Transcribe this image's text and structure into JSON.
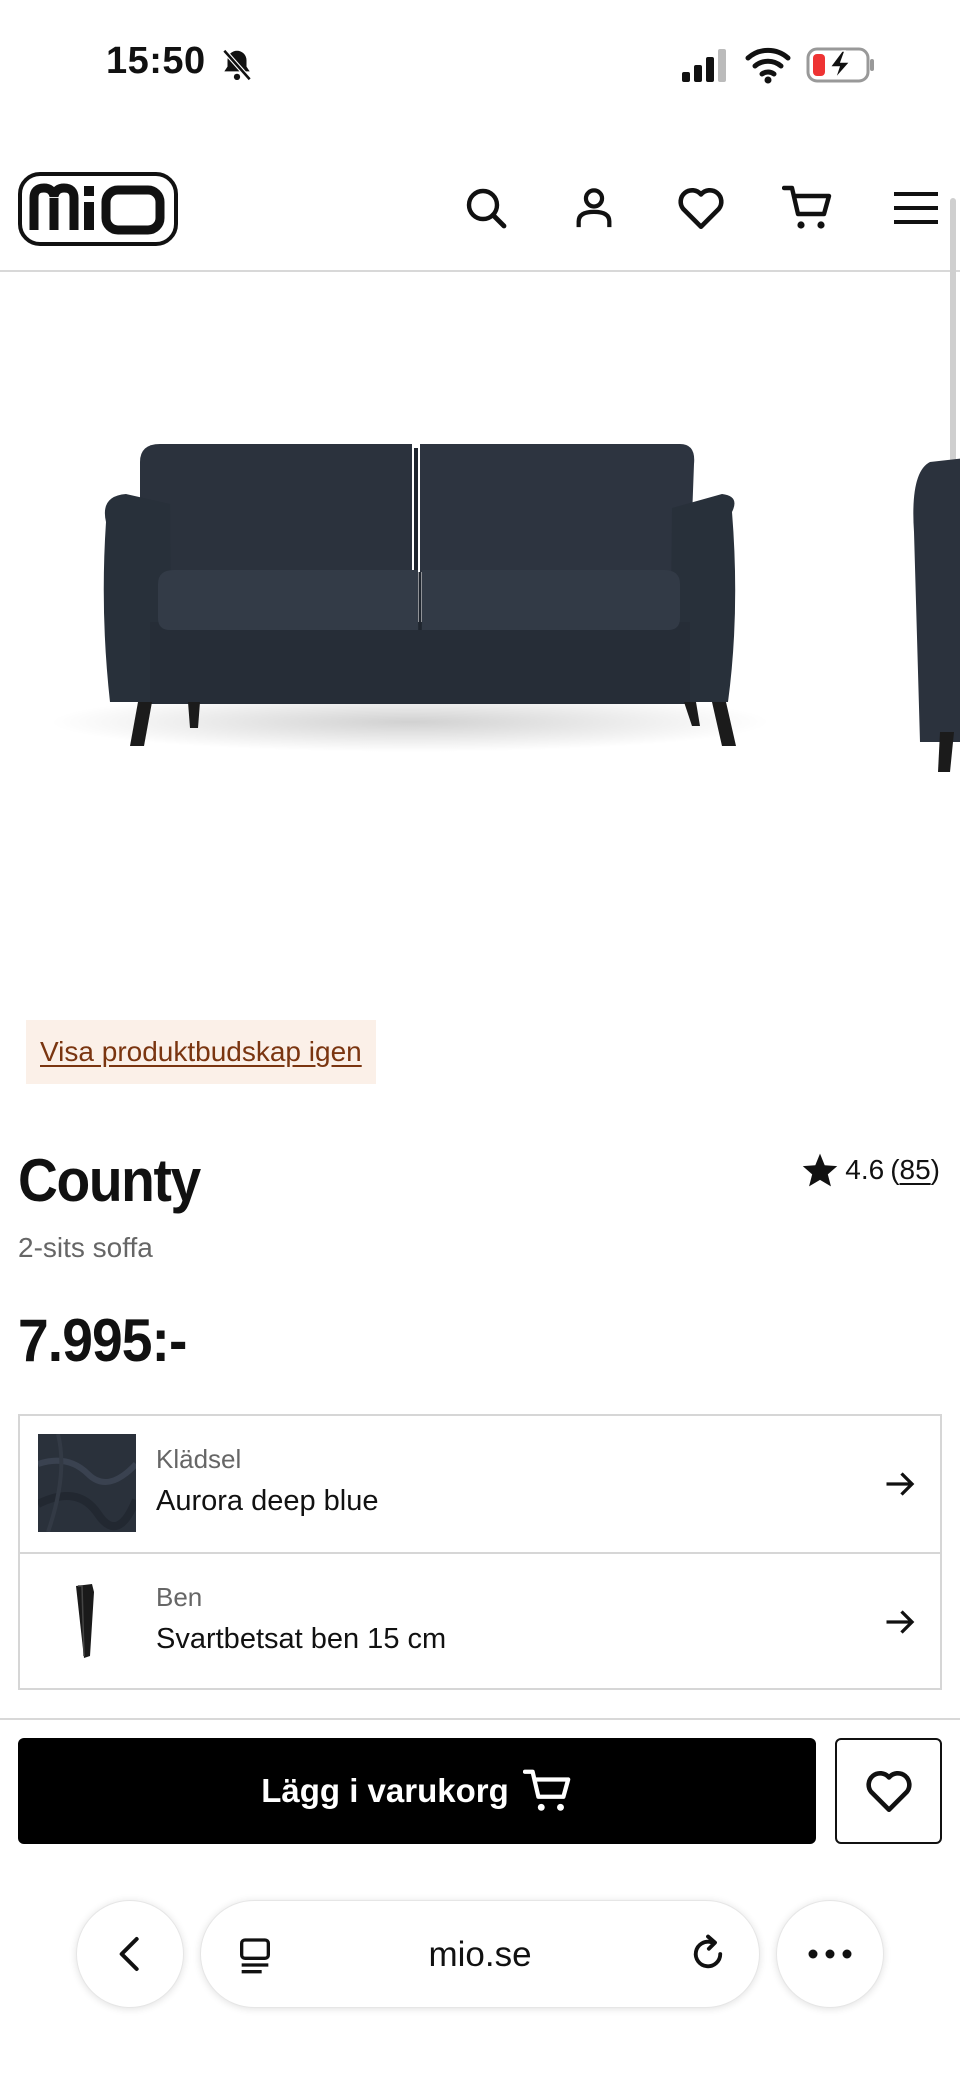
{
  "status_bar": {
    "time": "15:50"
  },
  "header": {
    "logo": "mio",
    "icons": [
      "search-icon",
      "user-icon",
      "heart-icon",
      "cart-icon",
      "menu-icon"
    ]
  },
  "banner": {
    "link_text": "Visa produktbudskap igen"
  },
  "product": {
    "name": "County",
    "subtitle": "2-sits soffa",
    "rating": "4.6",
    "review_count": "85",
    "price": "7.995:-"
  },
  "options": [
    {
      "label": "Klädsel",
      "value": "Aurora deep blue"
    },
    {
      "label": "Ben",
      "value": "Svartbetsat ben 15 cm"
    }
  ],
  "actions": {
    "add_to_cart": "Lägg i varukorg"
  },
  "browser": {
    "url": "mio.se"
  },
  "colors": {
    "sofa": "#2c3440",
    "price_text": "#000000",
    "banner_bg": "#fbf0e8",
    "banner_link": "#7a3510"
  }
}
